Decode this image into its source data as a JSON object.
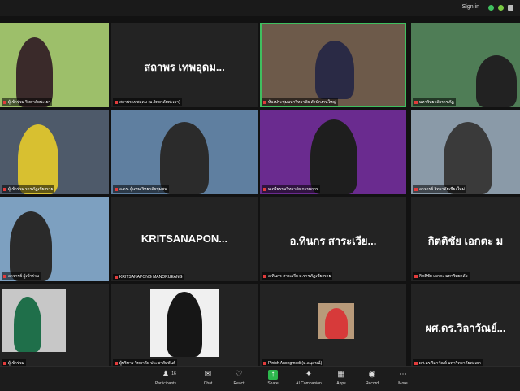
{
  "topbar": {
    "signin": "Sign in"
  },
  "tiles": [
    {
      "caption": "ผู้เข้าร่วม วิทยาลัยพะเยา"
    },
    {
      "name": "สถาพร เทพอุดม...",
      "caption": "สถาพร เทพอุดม (ม.วิทยาลัยพะเยา)"
    },
    {
      "caption": "ห้องประชุมมหาวิทยาลัย สำนักงานใหญ่"
    },
    {
      "caption": "มหาวิทยาลัยราชภัฏ"
    },
    {
      "caption": "ผู้เข้าร่วม ราชภัฏเชียงราย"
    },
    {
      "caption": "อ.ดร. ผู้แทน วิทยาลัยชุมชน"
    },
    {
      "caption": "ม.ศรีธรรมวิทยาลัย กรรมการ"
    },
    {
      "caption": "อาจารย์ วิทยาลัยเชียงใหม่"
    },
    {
      "caption": "อาจารย์ ผู้เข้าร่วม"
    },
    {
      "name": "KRITSANAPON...",
      "caption": "KRITSANAPONG MANORUEANG"
    },
    {
      "name": "อ.ทินกร สาระเวีย...",
      "caption": "อ.ทินกร สาระเวีย ม.ราชภัฏเชียงราย"
    },
    {
      "name": "กิตติชัย เอกตะ ม",
      "caption": "กิตติชัย เอกตะ มหาวิทยาลัย"
    },
    {
      "caption": "ผู้เข้าร่วม"
    },
    {
      "caption": "ผู้บริหาร วิทยาลัย ประชาสัมพันธ์"
    },
    {
      "caption": "Pinich Anongmedi (ม.อนุสรณ์)"
    },
    {
      "name": "ผศ.ดร.วิลาวัณย์...",
      "caption": "ผศ.ดร.วิลาวัณย์ มหาวิทยาลัยพะเยา"
    }
  ],
  "toolbar": [
    {
      "icon": "participants-icon",
      "label": "Participants",
      "count": "16"
    },
    {
      "icon": "chat-icon",
      "label": "Chat"
    },
    {
      "icon": "react-icon",
      "label": "React"
    },
    {
      "icon": "share-icon",
      "label": "Share"
    },
    {
      "icon": "ai-companion-icon",
      "label": "AI Companion"
    },
    {
      "icon": "apps-icon",
      "label": "Apps"
    },
    {
      "icon": "record-icon",
      "label": "Record"
    },
    {
      "icon": "more-icon",
      "label": "More"
    }
  ]
}
